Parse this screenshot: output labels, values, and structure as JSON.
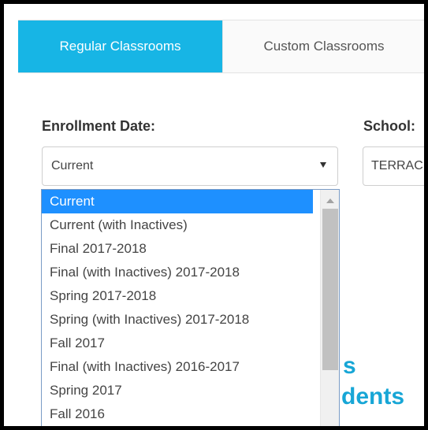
{
  "tabs": [
    {
      "label": "Regular Classrooms",
      "active": true
    },
    {
      "label": "Custom Classrooms",
      "active": false
    }
  ],
  "enrollment": {
    "label": "Enrollment Date:",
    "selected": "Current",
    "options": [
      "Current",
      "Current (with Inactives)",
      "Final 2017-2018",
      "Final (with Inactives) 2017-2018",
      "Spring 2017-2018",
      "Spring (with Inactives) 2017-2018",
      "Fall 2017",
      "Final (with Inactives) 2016-2017",
      "Spring 2017",
      "Fall 2016"
    ]
  },
  "school": {
    "label": "School:",
    "value": "TERRAC"
  },
  "background_text": {
    "fragment_1": "s",
    "fragment_2": "dents"
  },
  "colors": {
    "accent": "#17b5e5",
    "selected_option": "#1e90ff",
    "heading_fragment": "#17a6d6"
  }
}
